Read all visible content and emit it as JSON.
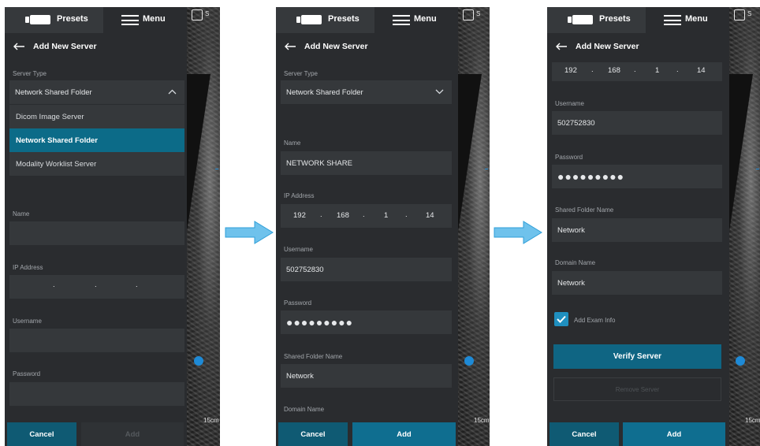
{
  "topbar": {
    "presets_label": "Presets",
    "menu_label": "Menu"
  },
  "header": {
    "title": "Add New Server"
  },
  "scan": {
    "icon_label": "S",
    "depth_label": "15cm"
  },
  "screen1": {
    "server_type_label": "Server Type",
    "server_type_value": "Network Shared Folder",
    "dropdown_options": [
      "Dicom Image Server",
      "Network Shared Folder",
      "Modality Worklist Server"
    ],
    "name_label": "Name",
    "ip_label": "IP Address",
    "ip_separators": [
      ".",
      ".",
      "."
    ],
    "username_label": "Username",
    "password_label": "Password",
    "cancel_label": "Cancel",
    "add_label": "Add"
  },
  "screen2": {
    "server_type_label": "Server Type",
    "server_type_value": "Network Shared Folder",
    "name_label": "Name",
    "name_value": "NETWORK SHARE",
    "ip_label": "IP Address",
    "ip": [
      "192",
      "168",
      "1",
      "14"
    ],
    "username_label": "Username",
    "username_value": "502752830",
    "password_label": "Password",
    "password_value": "●●●●●●●●●",
    "shared_folder_label": "Shared Folder Name",
    "shared_folder_value": "Network",
    "domain_label": "Domain Name",
    "cancel_label": "Cancel",
    "add_label": "Add"
  },
  "screen3": {
    "ip": [
      "192",
      "168",
      "1",
      "14"
    ],
    "username_label": "Username",
    "username_value": "502752830",
    "password_label": "Password",
    "password_value": "●●●●●●●●●",
    "shared_folder_label": "Shared Folder Name",
    "shared_folder_value": "Network",
    "domain_label": "Domain Name",
    "domain_value": "Network",
    "add_exam_info_label": "Add Exam Info",
    "add_exam_info_checked": true,
    "verify_label": "Verify Server",
    "remove_label": "Remove Server",
    "cancel_label": "Cancel",
    "add_label": "Add"
  },
  "colors": {
    "panel": "#2a2c2f",
    "field": "#35383b",
    "accent": "#0f6e90",
    "selected": "#0c6b88",
    "arrow": "#5bb7e6"
  }
}
